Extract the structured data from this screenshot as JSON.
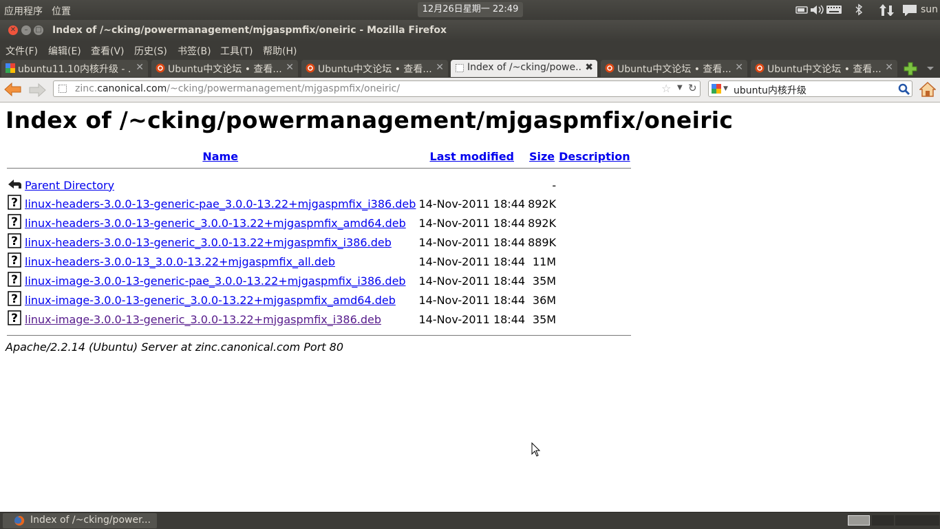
{
  "top_panel": {
    "applications": "应用程序",
    "places": "位置",
    "clock": "12月26日星期一 22:49",
    "username": "sun"
  },
  "window": {
    "title": "Index of /~cking/powermanagement/mjgaspmfix/oneiric - Mozilla Firefox"
  },
  "menu": [
    "文件(F)",
    "编辑(E)",
    "查看(V)",
    "历史(S)",
    "书签(B)",
    "工具(T)",
    "帮助(H)"
  ],
  "tabs": [
    {
      "label": "ubuntu11.10内核升级 - ...",
      "icon": "google-icon"
    },
    {
      "label": "Ubuntu中文论坛 • 查看...",
      "icon": "ubuntu-icon"
    },
    {
      "label": "Ubuntu中文论坛 • 查看...",
      "icon": "ubuntu-icon"
    },
    {
      "label": "Index of /~cking/powe...",
      "icon": "page-icon",
      "active": true
    },
    {
      "label": "Ubuntu中文论坛 • 查看...",
      "icon": "ubuntu-icon"
    },
    {
      "label": "Ubuntu中文论坛 • 查看...",
      "icon": "ubuntu-icon"
    }
  ],
  "navbar": {
    "url_prefix": "zinc.",
    "url_domain": "canonical.com",
    "url_path": "/~cking/powermanagement/mjgaspmfix/oneiric/",
    "search_value": "ubuntu内核升级"
  },
  "page": {
    "heading": "Index of /~cking/powermanagement/mjgaspmfix/oneiric",
    "columns": {
      "name": "Name",
      "last_modified": "Last modified",
      "size": "Size",
      "description": "Description"
    },
    "parent": {
      "name": "Parent Directory",
      "size": "-"
    },
    "files": [
      {
        "name": "linux-headers-3.0.0-13-generic-pae_3.0.0-13.22+mjgaspmfix_i386.deb",
        "modified": "14-Nov-2011 18:44",
        "size": "892K"
      },
      {
        "name": "linux-headers-3.0.0-13-generic_3.0.0-13.22+mjgaspmfix_amd64.deb",
        "modified": "14-Nov-2011 18:44",
        "size": "892K"
      },
      {
        "name": "linux-headers-3.0.0-13-generic_3.0.0-13.22+mjgaspmfix_i386.deb",
        "modified": "14-Nov-2011 18:44",
        "size": "889K"
      },
      {
        "name": "linux-headers-3.0.0-13_3.0.0-13.22+mjgaspmfix_all.deb",
        "modified": "14-Nov-2011 18:44",
        "size": "11M"
      },
      {
        "name": "linux-image-3.0.0-13-generic-pae_3.0.0-13.22+mjgaspmfix_i386.deb",
        "modified": "14-Nov-2011 18:44",
        "size": "35M"
      },
      {
        "name": "linux-image-3.0.0-13-generic_3.0.0-13.22+mjgaspmfix_amd64.deb",
        "modified": "14-Nov-2011 18:44",
        "size": "36M"
      },
      {
        "name": "linux-image-3.0.0-13-generic_3.0.0-13.22+mjgaspmfix_i386.deb",
        "modified": "14-Nov-2011 18:44",
        "size": "35M",
        "visited": true
      }
    ],
    "footer": "Apache/2.2.14 (Ubuntu) Server at zinc.canonical.com Port 80"
  },
  "taskbar": {
    "window_label": "Index of /~cking/power..."
  },
  "colors": {
    "panel": "#3c3b37",
    "link": "#0000ee",
    "visited_link": "#551a8b",
    "close_button": "#f0543c"
  }
}
